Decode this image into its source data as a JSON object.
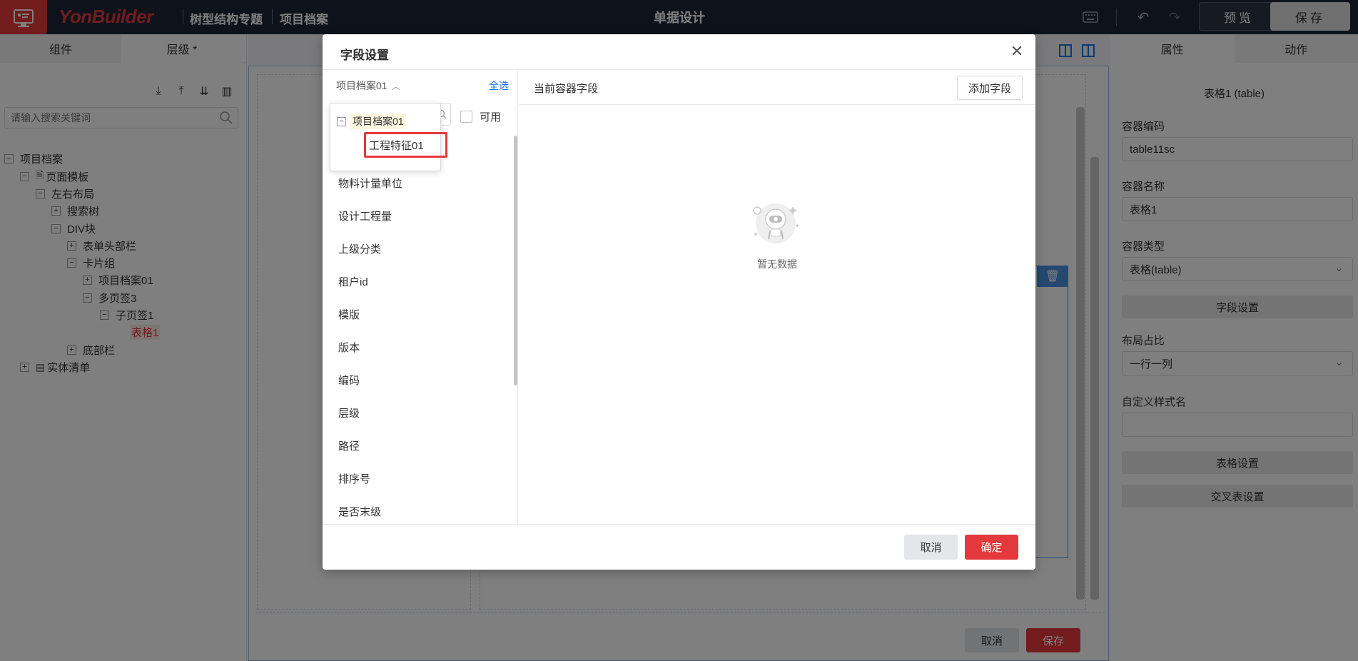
{
  "header": {
    "brand": "YonBuilder",
    "crumbs": [
      "树型结构专题",
      "项目档案"
    ],
    "center_title": "单据设计",
    "preview_label": "预览",
    "save_label": "保存"
  },
  "left_panel": {
    "tabs": [
      "组件",
      "层级 *"
    ],
    "search_placeholder": "请输入搜索关键词",
    "tree": [
      {
        "label": "项目档案",
        "toggle": "−"
      },
      {
        "label": "页面模板",
        "toggle": "−"
      },
      {
        "label": "左右布局",
        "toggle": "−"
      },
      {
        "label": "搜索树",
        "toggle": "+"
      },
      {
        "label": "DIV块",
        "toggle": "−"
      },
      {
        "label": "表单头部栏",
        "toggle": "+"
      },
      {
        "label": "卡片组",
        "toggle": "−"
      },
      {
        "label": "项目档案01",
        "toggle": "+"
      },
      {
        "label": "多页签3",
        "toggle": "−"
      },
      {
        "label": "子页签1",
        "toggle": "−"
      },
      {
        "label": "表格1",
        "toggle": ""
      },
      {
        "label": "底部栏",
        "toggle": "+"
      },
      {
        "label": "实体清单",
        "toggle": "+"
      }
    ]
  },
  "canvas": {
    "cancel_label": "取消",
    "save_label": "保存"
  },
  "right_panel": {
    "tabs": [
      "属性",
      "动作"
    ],
    "title": "表格1 (table)",
    "code_label": "容器编码",
    "code_value": "table11sc",
    "name_label": "容器名称",
    "name_value": "表格1",
    "type_label": "容器类型",
    "type_value": "表格(table)",
    "field_settings_btn": "字段设置",
    "layout_label": "布局占比",
    "layout_value": "一行一列",
    "style_label": "自定义样式名",
    "style_value": "",
    "table_settings_btn": "表格设置",
    "cross_table_btn": "交叉表设置"
  },
  "modal": {
    "title": "字段设置",
    "entity_select": "项目档案01",
    "select_all": "全选",
    "available_label": "可用",
    "dropdown_root": "项目档案01",
    "dropdown_child": "工程特征01",
    "fields": [
      "物料计量单位",
      "设计工程量",
      "上级分类",
      "租户id",
      "模版",
      "版本",
      "编码",
      "层级",
      "路径",
      "排序号",
      "是否末级"
    ],
    "right_title": "当前容器字段",
    "add_field": "添加字段",
    "empty_text": "暂无数据",
    "cancel": "取消",
    "ok": "确定"
  },
  "colors": {
    "accent_red": "#e4393c",
    "link_blue": "#1a73e8",
    "header_bg": "#1d2437"
  }
}
